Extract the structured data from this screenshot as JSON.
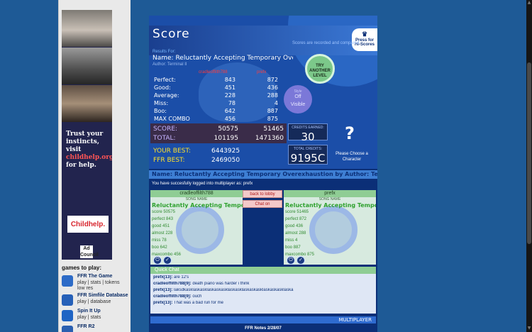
{
  "ad": {
    "message_line1": "Trust your",
    "message_line2": "instincts,",
    "message_line3": "visit",
    "message_link": "childhelp.org",
    "message_line4": "for help.",
    "logo": "Childhelp.",
    "ad_choice": "Ad Council"
  },
  "games": {
    "heading": "games to play:",
    "items": [
      {
        "name": "FFR The Game",
        "links": "play | stats | tokens",
        "links2": "low res",
        "icon_color": "#2d6bc7"
      },
      {
        "name": "FFR Simfile Database",
        "links": "play | database",
        "links2": "",
        "icon_color": "#2660b8"
      },
      {
        "name": "Spin It Up",
        "links": "play | stats",
        "links2": "",
        "icon_color": "#1f64c4"
      },
      {
        "name": "FFR R2",
        "links": "",
        "links2": "",
        "icon_color": "#2a5fb0"
      }
    ]
  },
  "score": {
    "title": "Score",
    "press_for": "Press for",
    "hi_scores": "Hi-Scores",
    "recorded": "Scores are recorded and compared",
    "results_for": "Results For:",
    "song_name": "Name: Reluctantly Accepting Temporary Overexhaustion",
    "author": "Author: Terminal II",
    "col1_head": "cradleoffilth788",
    "col2_head": "prefx",
    "rows": [
      {
        "label": "Perfect:",
        "v1": "843",
        "v2": "872"
      },
      {
        "label": "Good:",
        "v1": "451",
        "v2": "436"
      },
      {
        "label": "Average:",
        "v1": "228",
        "v2": "288"
      },
      {
        "label": "Miss:",
        "v1": "78",
        "v2": "4"
      },
      {
        "label": "Boo:",
        "v1": "642",
        "v2": "887"
      },
      {
        "label": "MAX COMBO",
        "v1": "456",
        "v2": "875"
      }
    ],
    "try_another": [
      "TRY",
      "ANOTHER",
      "LEVEL"
    ],
    "toggle": {
      "label": "Style",
      "off": "Off",
      "visible": "Visible"
    },
    "score_label": "SCORE:",
    "score_v1": "50575",
    "score_v2": "51465",
    "total_label": "TOTAL:",
    "total_v1": "101195",
    "total_v2": "1471360",
    "your_best_label": "YOUR BEST:",
    "your_best_value": "6443925",
    "ffr_best_label": "FFR BEST:",
    "ffr_best_value": "2469050",
    "credits_earned_label": "CREDITS EARNED:",
    "credits_earned_value": "30",
    "total_credits_label": "TOTAL CREDITS:",
    "total_credits_value": "9195C",
    "please_choose": "Please Choose a Character",
    "question_mark": "?"
  },
  "multiplayer": {
    "header": "Name: Reluctantly Accepting Temporary Overexhaustion by Author: Te",
    "logged_in": "You have succesfully logged into multiplayer as: prefx",
    "back_to_lobby": "back to lobby",
    "chat_on": "Chat on",
    "song_name_label": "SONG NAME",
    "left_player": {
      "name": "cradleoffilth788",
      "song": "Reluctantly Accepting Tempo",
      "stats": [
        "score 50575",
        "perfect 843",
        "good 451",
        "almost 228",
        "miss 78",
        "boo 642",
        "maxcombo 456"
      ]
    },
    "right_player": {
      "name": "prefx",
      "song": "Reluctantly Accepting Tempo",
      "stats": [
        "score 51465",
        "perfect 872",
        "good 436",
        "almost 288",
        "miss 4",
        "boo 887",
        "maxcombo 875"
      ]
    },
    "chat_title": "Quick Chat",
    "chat": [
      {
        "user": "prefx[13]:",
        "text": "are 12's"
      },
      {
        "user": "cradleoffilth788[9]:",
        "text": "death piano was harder i think"
      },
      {
        "user": "prefx[13]:",
        "text": "laksdkasklaskasklaskaskasklaskasklaskaskasklaskaskasklaska"
      },
      {
        "user": "cradleoffilth788[9]:",
        "text": "ouch"
      },
      {
        "user": "prefx[13]:",
        "text": "That was a bad run for me"
      }
    ],
    "bottom_bar": "MULTIPLAYER",
    "footer": "FFR Notes 2/28/07"
  },
  "colors": {
    "background": "#1e5a96",
    "game_bg": "#0b2f77",
    "accent_green": "#8fcd94"
  }
}
